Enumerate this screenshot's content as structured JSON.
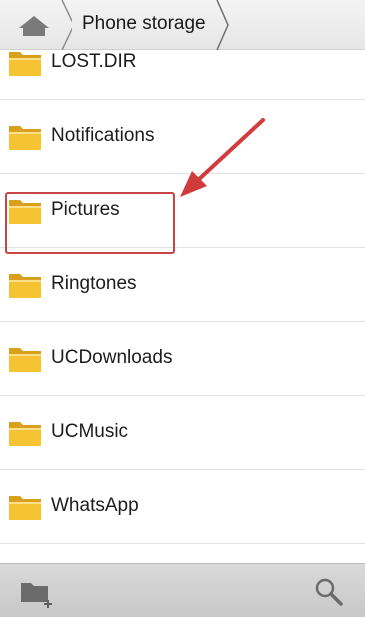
{
  "breadcrumb": {
    "home_icon": "home-icon",
    "current": "Phone storage"
  },
  "folders": [
    {
      "label": "LOST.DIR",
      "icon": "folder-icon"
    },
    {
      "label": "Notifications",
      "icon": "folder-icon"
    },
    {
      "label": "Pictures",
      "icon": "folder-icon",
      "highlighted": true
    },
    {
      "label": "Ringtones",
      "icon": "folder-icon"
    },
    {
      "label": "UCDownloads",
      "icon": "folder-icon"
    },
    {
      "label": "UCMusic",
      "icon": "folder-icon"
    },
    {
      "label": "WhatsApp",
      "icon": "folder-icon"
    }
  ],
  "toolbar": {
    "new_folder_icon": "new-folder-icon",
    "search_icon": "search-icon"
  },
  "colors": {
    "highlight": "#c94545",
    "folder_fill": "#f6c433",
    "folder_dark": "#d9a01e"
  }
}
